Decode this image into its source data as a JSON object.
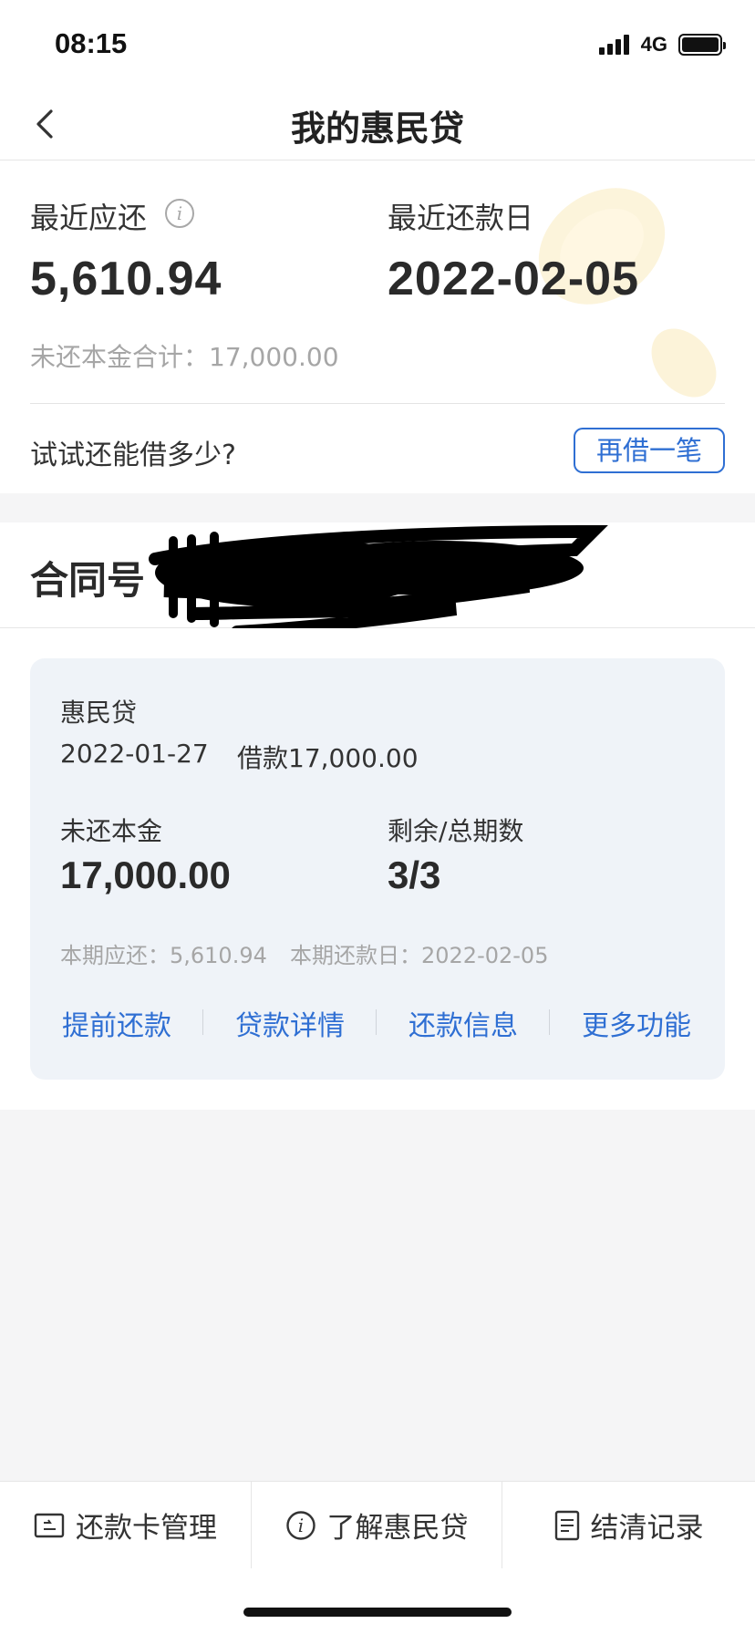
{
  "status_bar": {
    "time": "08:15",
    "network": "4G"
  },
  "header": {
    "title": "我的惠民贷"
  },
  "summary": {
    "due_label": "最近应还",
    "due_amount": "5,610.94",
    "date_label": "最近还款日",
    "date_value": "2022-02-05",
    "principal_line": "未还本金合计：17,000.00",
    "try_text": "试试还能借多少?",
    "borrow_again_button": "再借一笔"
  },
  "contract": {
    "label": "合同号"
  },
  "loan_card": {
    "product": "惠民贷",
    "loan_date": "2022-01-27",
    "loan_amount_text": "借款17,000.00",
    "principal_label": "未还本金",
    "principal_value": "17,000.00",
    "periods_label": "剩余/总期数",
    "periods_value": "3/3",
    "current_due_text": "本期应还：5,610.94",
    "current_date_text": "本期还款日：2022-02-05",
    "actions": [
      "提前还款",
      "贷款详情",
      "还款信息",
      "更多功能"
    ]
  },
  "bottom_tabs": [
    {
      "label": "还款卡管理",
      "icon": "card-icon"
    },
    {
      "label": "了解惠民贷",
      "icon": "info-icon"
    },
    {
      "label": "结清记录",
      "icon": "document-icon"
    }
  ],
  "colors": {
    "accent": "#2f6fd3",
    "muted_text": "#a6a6a6",
    "card_bg": "#eff3f8",
    "page_bg": "#f5f5f6"
  }
}
